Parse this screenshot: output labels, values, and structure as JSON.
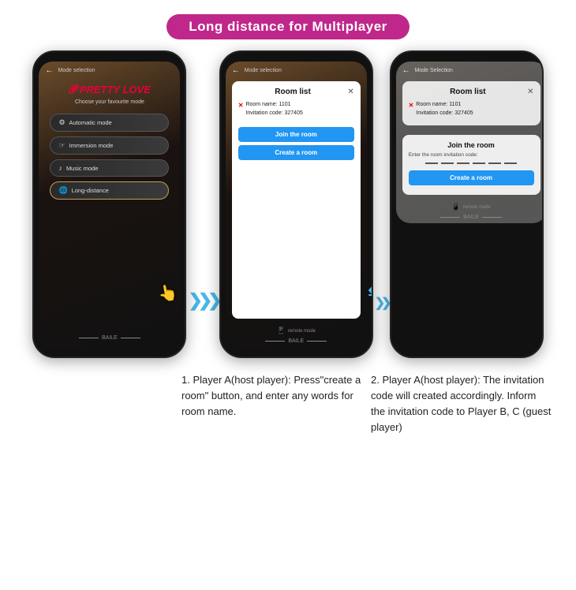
{
  "title": "Long distance for Multiplayer",
  "phones": [
    {
      "id": "phone1",
      "header": {
        "back": "←",
        "mode_selection": "Mode selection"
      },
      "logo": "PRETTY LOVE",
      "subtitle": "Choose your favourite mode",
      "modes": [
        {
          "icon": "⚙",
          "label": "Automatic mode"
        },
        {
          "icon": "👆",
          "label": "Immersion mode"
        },
        {
          "icon": "♪",
          "label": "Music mode"
        },
        {
          "icon": "🌐",
          "label": "Long-distance",
          "selected": true
        }
      ],
      "footer": "BAILE"
    },
    {
      "id": "phone2",
      "header": {
        "back": "←",
        "mode_selection": "Mode selection"
      },
      "modal": {
        "title": "Room list",
        "close": "✕",
        "room_name_label": "Room name:",
        "room_name_value": "1101",
        "invitation_code_label": "Invitation code:",
        "invitation_code_value": "327405"
      },
      "buttons": {
        "join": "Join the room",
        "create": "Create a room"
      },
      "footer": "remote mode",
      "footer_baile": "BAILE"
    },
    {
      "id": "phone3",
      "header": {
        "back": "←",
        "mode_selection": "Mode Selection"
      },
      "modal_top": {
        "title": "Room list",
        "close": "✕",
        "room_name_label": "Room name:",
        "room_name_value": "1101",
        "invitation_code_label": "Invitation code:",
        "invitation_code_value": "327405"
      },
      "join_section": {
        "title": "Join the room",
        "subtitle": "Enter the room invitation code:",
        "dashes": 6,
        "create_button": "Create a room"
      },
      "footer": "remote mode",
      "footer_baile": "BAILE"
    }
  ],
  "arrows": {
    "double": "»»",
    "small": "»"
  },
  "descriptions": [
    {
      "number": "1.",
      "text": "Player A(host player): Press\"create a room\" button, and enter any words for room name."
    },
    {
      "number": "2.",
      "text": "Player A(host player): The invitation code will created accordingly. Inform the invitation code to Player B, C (guest player)"
    }
  ]
}
